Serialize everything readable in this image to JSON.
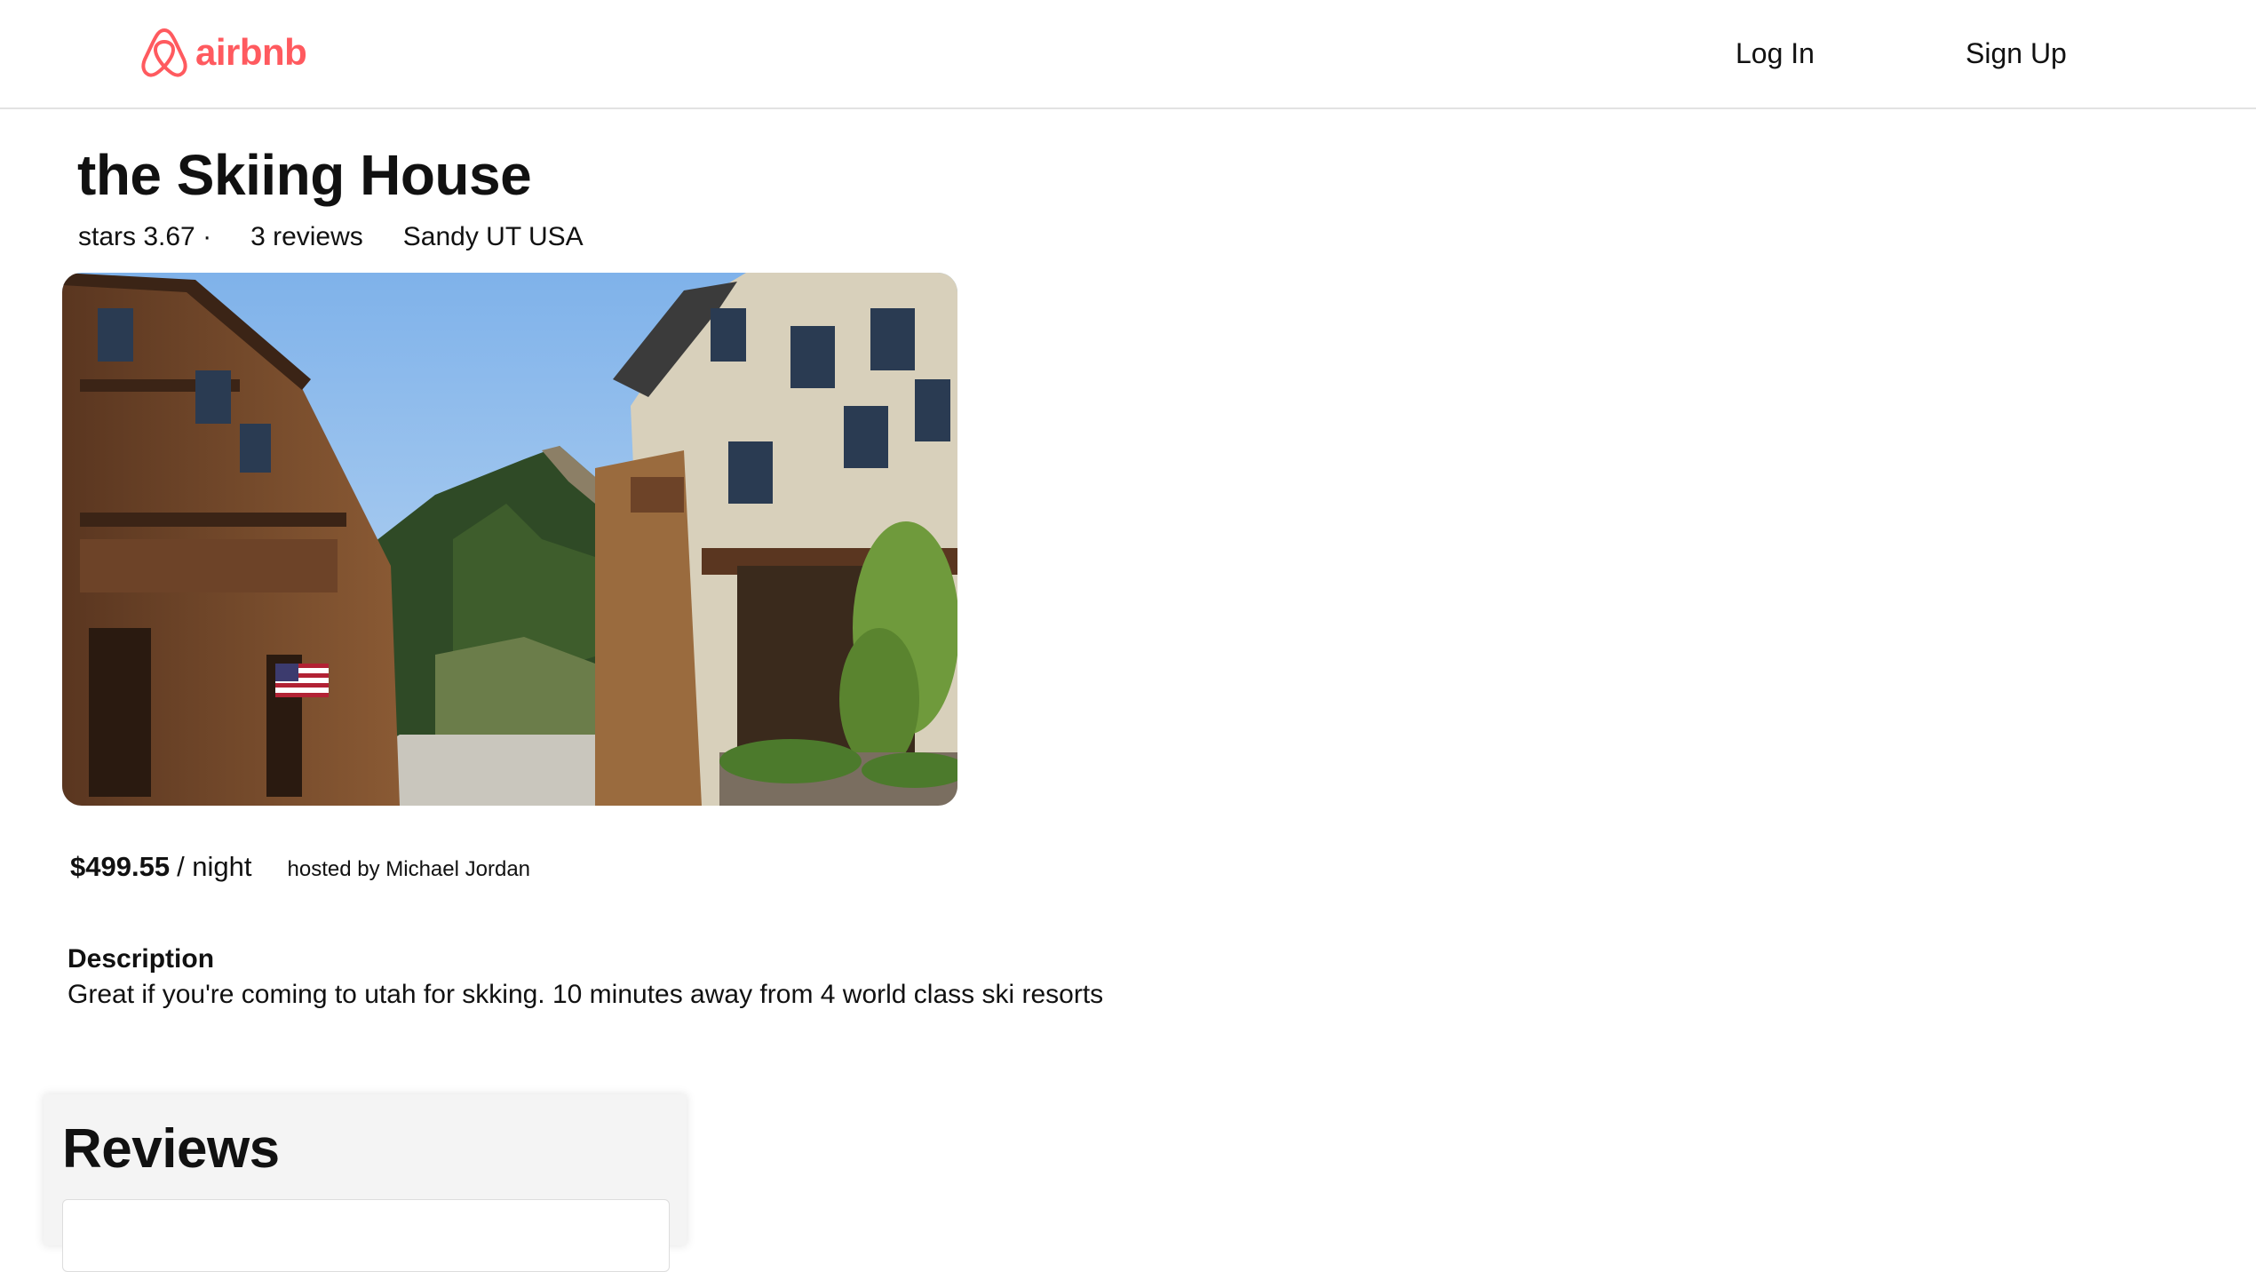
{
  "header": {
    "logo_text": "airbnb",
    "login_label": "Log In",
    "signup_label": "Sign Up"
  },
  "listing": {
    "title": "the Skiing House",
    "stars": "stars 3.67 ·",
    "reviews_count": "3 reviews",
    "location": "Sandy UT USA",
    "photo_alt": "the Skiing House",
    "price": "$499.55",
    "price_unit": "/ night",
    "host": "hosted by Michael Jordan",
    "description_label": "Description",
    "description": "Great if you're coming to utah for skking. 10 minutes away from 4 world class ski resorts"
  },
  "reviews": {
    "title": "Reviews"
  },
  "colors": {
    "brand": "#ff5a5f",
    "header_border": "#e2e2e2",
    "reviews_bg": "#f4f4f4"
  },
  "icons": {
    "logo": "airbnb-logo-icon"
  }
}
